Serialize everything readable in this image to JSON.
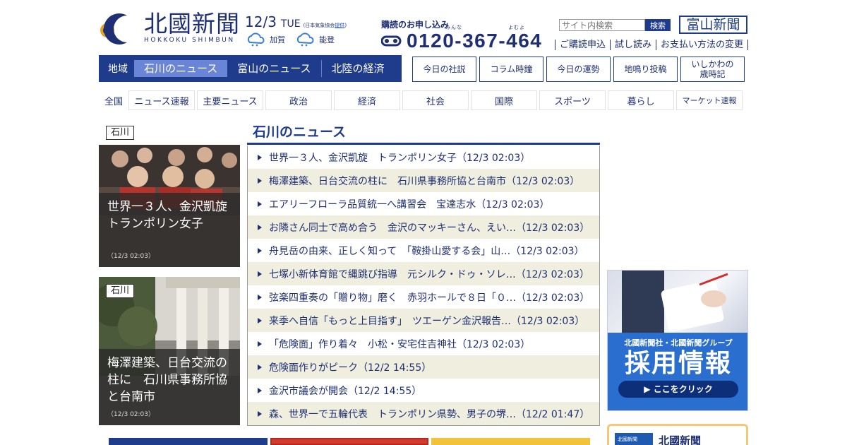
{
  "header": {
    "logo_name": "北國新聞",
    "logo_roman": "HOKKOKU SHIMBUN",
    "date_day": "12/3",
    "date_weekday": "TUE",
    "weather_note_prefix": "(日本気象協会",
    "weather_note_link": "提供",
    "weather_note_suffix": ")",
    "weather_kaga": "加賀",
    "weather_noto": "能登",
    "subscribe_label": "購読のお申し込み",
    "ruby_minna": "みんな",
    "ruby_yomou": "よむよ",
    "phone": "0120-367-464",
    "search_placeholder": "サイト内検索",
    "search_button": "検索",
    "toyama_logo": "富山新聞",
    "util_links": [
      "ご購読申込",
      "試し読み",
      "お支払い方法の変更"
    ]
  },
  "region_nav": {
    "label": "地域",
    "tabs": [
      "石川のニュース",
      "富山のニュース",
      "北陸の経済"
    ]
  },
  "column_buttons": [
    "今日の社説",
    "コラム時鐘",
    "今日の運勢",
    "地鳴り投稿",
    "いしかわの\n歳時記"
  ],
  "genre_nav": {
    "label": "全国",
    "items": [
      "ニュース速報",
      "主要ニュース",
      "政治",
      "経済",
      "社会",
      "国際",
      "スポーツ",
      "暮らし",
      "マーケット速報"
    ]
  },
  "features": [
    {
      "tag": "石川",
      "title": "世界一３人、金沢凱旋　トランポリン女子",
      "time": "（12/3 02:03）"
    },
    {
      "tag": "石川",
      "title": "梅澤建築、日台交流の柱に　石川県事務所協と台南市",
      "time": "（12/3 02:03）"
    }
  ],
  "news_section": {
    "title": "石川のニュース",
    "items": [
      "世界一３人、金沢凱旋　トランポリン女子（12/3 02:03）",
      "梅澤建築、日台交流の柱に　石川県事務所協と台南市（12/3 02:03）",
      "エアリーフローラ品質統一へ講習会　宝達志水（12/3 02:03）",
      "お隣さん同士で高め合う　金沢のマッキーさん、えい…（12/3 02:03）",
      "舟見岳の由来、正しく知って　「鞍掛山愛する会」山…（12/3 02:03）",
      "七塚小新体育館で縄跳び指導　元シルク・ドゥ・ソレ…（12/3 02:03）",
      "弦楽四重奏の「贈り物」磨く　赤羽ホールで８日「０…（12/3 02:03）",
      "来季へ自信「もっと上目指す」　ツエーゲン金沢報告…（12/3 02:03）",
      "「危険面」作り着々　小松・安宅住吉神社（12/3 02:03）",
      "危険面作りがピーク（12/2 14:55）",
      "金沢市議会が開会（12/2 14:55）",
      "森、世界一で五輪代表　トランポリン県勢、男子の堺…（12/2 01:47）"
    ]
  },
  "recruit_ad": {
    "sub": "北國新聞社・北國新聞グループ",
    "main": "採用情報",
    "button": "▶ ここをクリック"
  },
  "ad_box2": {
    "mini": "北國新聞",
    "text": "北國新聞"
  },
  "colors": {
    "brand_navy": "#1e3b8c",
    "active_tab": "#6b85d6",
    "row_alt": "#efeedf",
    "recruit_blue": "#2a6fd0"
  }
}
